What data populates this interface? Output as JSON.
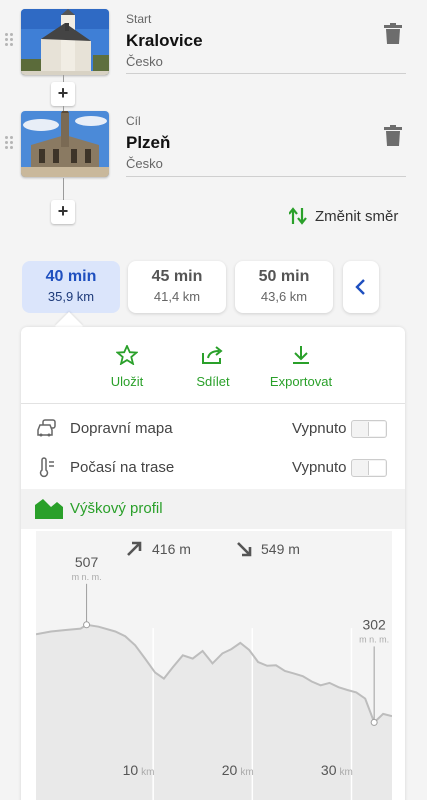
{
  "waypoints": [
    {
      "type": "Start",
      "name": "Kralovice",
      "country": "Česko"
    },
    {
      "type": "Cíl",
      "name": "Plzeň",
      "country": "Česko"
    }
  ],
  "swap_label": "Změnit směr",
  "routes": [
    {
      "time": "40 min",
      "distance": "35,9 km",
      "selected": true
    },
    {
      "time": "45 min",
      "distance": "41,4 km",
      "selected": false
    },
    {
      "time": "50 min",
      "distance": "43,6 km",
      "selected": false
    }
  ],
  "actions": {
    "save": "Uložit",
    "share": "Sdílet",
    "export": "Exportovat"
  },
  "options": [
    {
      "label": "Dopravní mapa",
      "value": "Vypnuto",
      "icon": "traffic-car-icon"
    },
    {
      "label": "Počasí na trase",
      "value": "Vypnuto",
      "icon": "thermometer-icon"
    }
  ],
  "elevation": {
    "title": "Výškový profil",
    "ascent": "416 m",
    "descent": "549 m",
    "max_value": "507",
    "max_unit": "m n. m.",
    "end_value": "302",
    "end_unit": "m n. m.",
    "tick_unit": "km"
  },
  "chart_data": {
    "type": "area",
    "x_unit": "km",
    "y_unit": "m n. m.",
    "x_ticks": [
      10,
      20,
      30
    ],
    "xlim": [
      0,
      35.9
    ],
    "ylim": [
      200,
      620
    ],
    "x": [
      0,
      1.5,
      3,
      4.5,
      5.1,
      6.3,
      8,
      9,
      10,
      11,
      12,
      12.9,
      13.8,
      14.8,
      15.8,
      16.8,
      17.8,
      18.8,
      19.7,
      20.6,
      21.5,
      22.4,
      23.3,
      24.2,
      25.1,
      26,
      26.9,
      27.8,
      28.7,
      29.6,
      30.5,
      31.4,
      32.3,
      33.2,
      34.1,
      35,
      35.9
    ],
    "y": [
      487,
      493,
      496,
      499,
      507,
      503,
      493,
      483,
      464,
      436,
      407,
      394,
      418,
      443,
      436,
      452,
      426,
      447,
      456,
      469,
      454,
      429,
      421,
      422,
      410,
      405,
      399,
      388,
      380,
      385,
      376,
      370,
      365,
      352,
      302,
      320,
      315
    ],
    "markers": [
      {
        "x": 5.1,
        "y": 507,
        "label": "507"
      },
      {
        "x": 34.1,
        "y": 302,
        "label": "302"
      }
    ]
  },
  "colors": {
    "accent": "#2aa02a",
    "selected_tab_bg": "#dbe5fb",
    "selected_tab_text": "#1e4fbf"
  }
}
